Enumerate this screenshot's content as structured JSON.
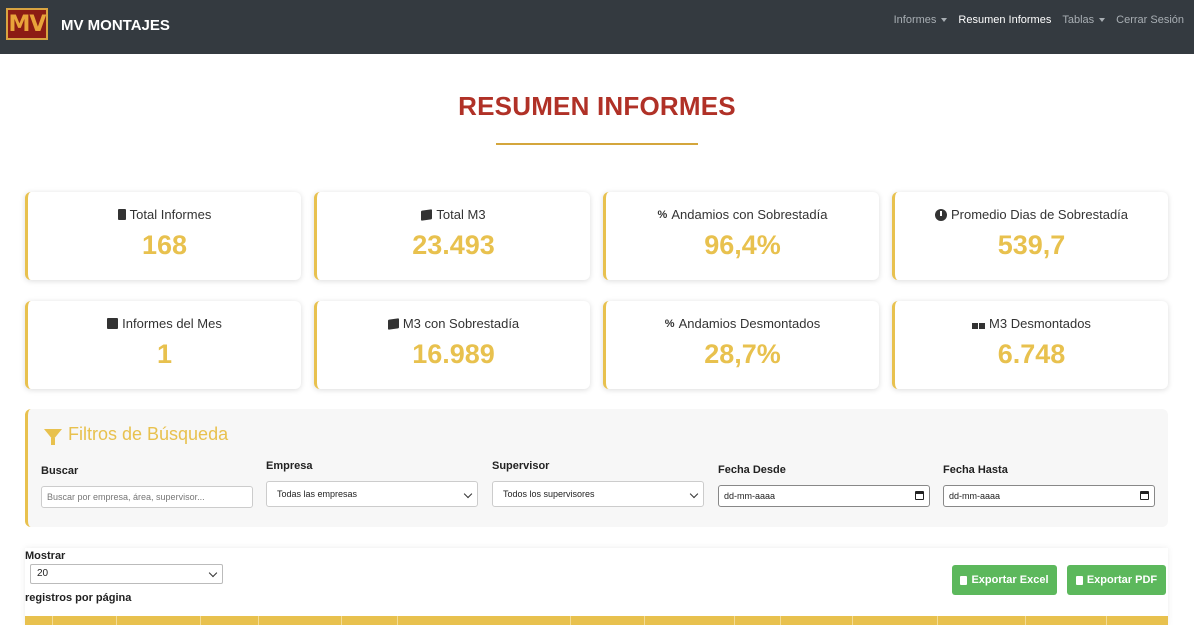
{
  "brand": {
    "logo_text": "MV",
    "name": "MV MONTAJES"
  },
  "nav": {
    "items": [
      {
        "label": "Informes",
        "dropdown": true,
        "active": false
      },
      {
        "label": "Resumen Informes",
        "dropdown": false,
        "active": true
      },
      {
        "label": "Tablas",
        "dropdown": true,
        "active": false
      },
      {
        "label": "Cerrar Sesión",
        "dropdown": false,
        "active": false
      }
    ]
  },
  "page": {
    "title": "RESUMEN INFORMES"
  },
  "stats": [
    {
      "label": "Total Informes",
      "value": "168",
      "icon": "clipboard-icon"
    },
    {
      "label": "Total M3",
      "value": "23.493",
      "icon": "cube-icon"
    },
    {
      "label": "Andamios con Sobrestadía",
      "value": "96,4%",
      "icon": "percent-icon"
    },
    {
      "label": "Promedio Dias de Sobrestadía",
      "value": "539,7",
      "icon": "clock-icon"
    },
    {
      "label": "Informes del Mes",
      "value": "1",
      "icon": "calendar-icon"
    },
    {
      "label": "M3 con Sobrestadía",
      "value": "16.989",
      "icon": "cube-icon"
    },
    {
      "label": "Andamios Desmontados",
      "value": "28,7%",
      "icon": "percent-icon"
    },
    {
      "label": "M3 Desmontados",
      "value": "6.748",
      "icon": "cubes-icon"
    }
  ],
  "filters": {
    "title": "Filtros de Búsqueda",
    "search": {
      "label": "Buscar",
      "placeholder": "Buscar por empresa, área, supervisor..."
    },
    "empresa": {
      "label": "Empresa",
      "value": "Todas las empresas"
    },
    "supervisor": {
      "label": "Supervisor",
      "value": "Todos los supervisores"
    },
    "fecha_desde": {
      "label": "Fecha Desde",
      "value": "dd-mm-aaaa"
    },
    "fecha_hasta": {
      "label": "Fecha Hasta",
      "value": "dd-mm-aaaa"
    }
  },
  "table_controls": {
    "show_label": "Mostrar",
    "page_length": "20",
    "per_page_label": "registros por página",
    "export_excel": "Exportar Excel",
    "export_pdf": "Exportar PDF"
  },
  "colors": {
    "navbar": "#343a40",
    "title": "#b03127",
    "accent": "#e8c14e",
    "button": "#5cb85c"
  }
}
